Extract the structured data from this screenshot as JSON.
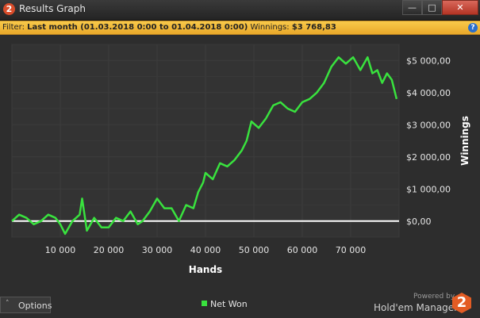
{
  "window": {
    "title": "Results Graph",
    "min_glyph": "—",
    "max_glyph": "□",
    "close_glyph": "✕"
  },
  "filter": {
    "prefix": "Filter:",
    "period": "Last month (01.03.2018 0:00 to 01.04.2018 0:00)",
    "winnings_label": "Winnings:",
    "winnings_value": "$3 768,83"
  },
  "colors": {
    "background": "#2d2d2d",
    "line": "#39e23e",
    "filterbar": "#f3b93a",
    "zero_line": "#ffffff"
  },
  "chart_data": {
    "type": "line",
    "xlabel": "Hands",
    "ylabel": "Winnings",
    "xlim": [
      0,
      80000
    ],
    "ylim": [
      -500,
      5500
    ],
    "x_ticks": [
      10000,
      20000,
      30000,
      40000,
      50000,
      60000,
      70000
    ],
    "x_tick_labels": [
      "10 000",
      "20 000",
      "30 000",
      "40 000",
      "50 000",
      "60 000",
      "70 000"
    ],
    "y_ticks": [
      0,
      1000,
      2000,
      3000,
      4000,
      5000
    ],
    "y_tick_labels": [
      "$0,00",
      "$1 000,00",
      "$2 000,00",
      "$3 000,00",
      "$4 000,00",
      "$5 000,00"
    ],
    "grid": true,
    "legend_position": "bottom",
    "series": [
      {
        "name": "Net Won",
        "x": [
          0,
          1500,
          3000,
          4500,
          6000,
          7500,
          9000,
          10000,
          11000,
          12500,
          14000,
          14500,
          15500,
          17000,
          18500,
          20000,
          21500,
          23000,
          24500,
          26000,
          27000,
          28500,
          30000,
          31500,
          33000,
          34500,
          36000,
          37500,
          38500,
          39500,
          40000,
          41500,
          43000,
          44500,
          46000,
          47500,
          48500,
          49500,
          51000,
          52500,
          54000,
          55500,
          57000,
          58500,
          60000,
          61500,
          63000,
          64500,
          66000,
          67500,
          69000,
          70500,
          72000,
          73500,
          74500,
          75500,
          76500,
          77500,
          78500,
          79500
        ],
        "values": [
          0,
          200,
          100,
          -100,
          0,
          200,
          100,
          -100,
          -400,
          0,
          200,
          700,
          -300,
          100,
          -200,
          -200,
          100,
          0,
          300,
          -100,
          0,
          300,
          700,
          400,
          400,
          0,
          500,
          400,
          900,
          1200,
          1500,
          1300,
          1800,
          1700,
          1900,
          2200,
          2500,
          3100,
          2900,
          3200,
          3600,
          3700,
          3500,
          3400,
          3700,
          3800,
          4000,
          4300,
          4800,
          5100,
          4900,
          5100,
          4700,
          5100,
          4600,
          4700,
          4300,
          4600,
          4400,
          3800
        ]
      }
    ]
  },
  "footer": {
    "options_chevron": "˄",
    "options_label": "Options",
    "powered_by": "Powered by",
    "brand": "Hold'em Manager",
    "brand_logo": "2"
  }
}
